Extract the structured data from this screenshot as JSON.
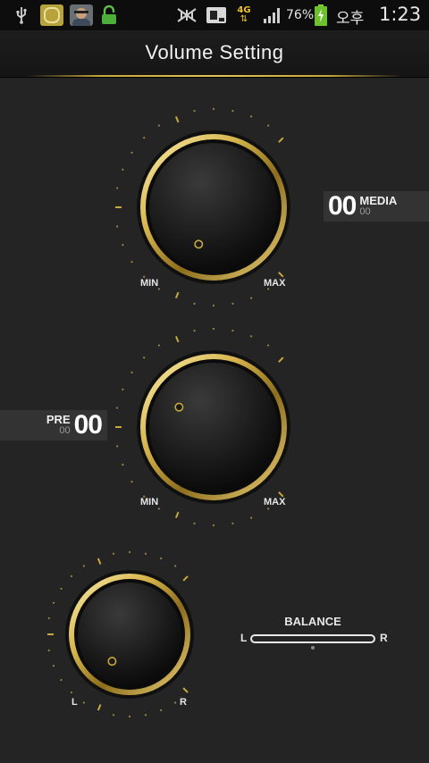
{
  "status_bar": {
    "battery_percent": "76%",
    "ampm": "오후",
    "time": "1:23",
    "network": "4G",
    "icons": [
      "usb-icon",
      "notification-app-icon",
      "avatar-icon",
      "lock-icon",
      "no-signal-icon",
      "sim-icon",
      "4g-data-icon",
      "signal-bars-icon",
      "battery-charging-icon"
    ]
  },
  "header": {
    "title": "Volume Setting"
  },
  "colors": {
    "gold": "#c9a83c",
    "background": "#242424",
    "badge": "#333333"
  },
  "media_knob": {
    "min_label": "MIN",
    "max_label": "MAX",
    "value": "00",
    "label": "MEDIA",
    "sub_value": "00"
  },
  "pre_knob": {
    "min_label": "MIN",
    "max_label": "MAX",
    "value": "00",
    "label": "PRE",
    "sub_value": "00"
  },
  "balance_knob": {
    "left_label": "L",
    "right_label": "R"
  },
  "balance": {
    "title": "BALANCE",
    "left": "L",
    "right": "R",
    "position": 0.5
  }
}
